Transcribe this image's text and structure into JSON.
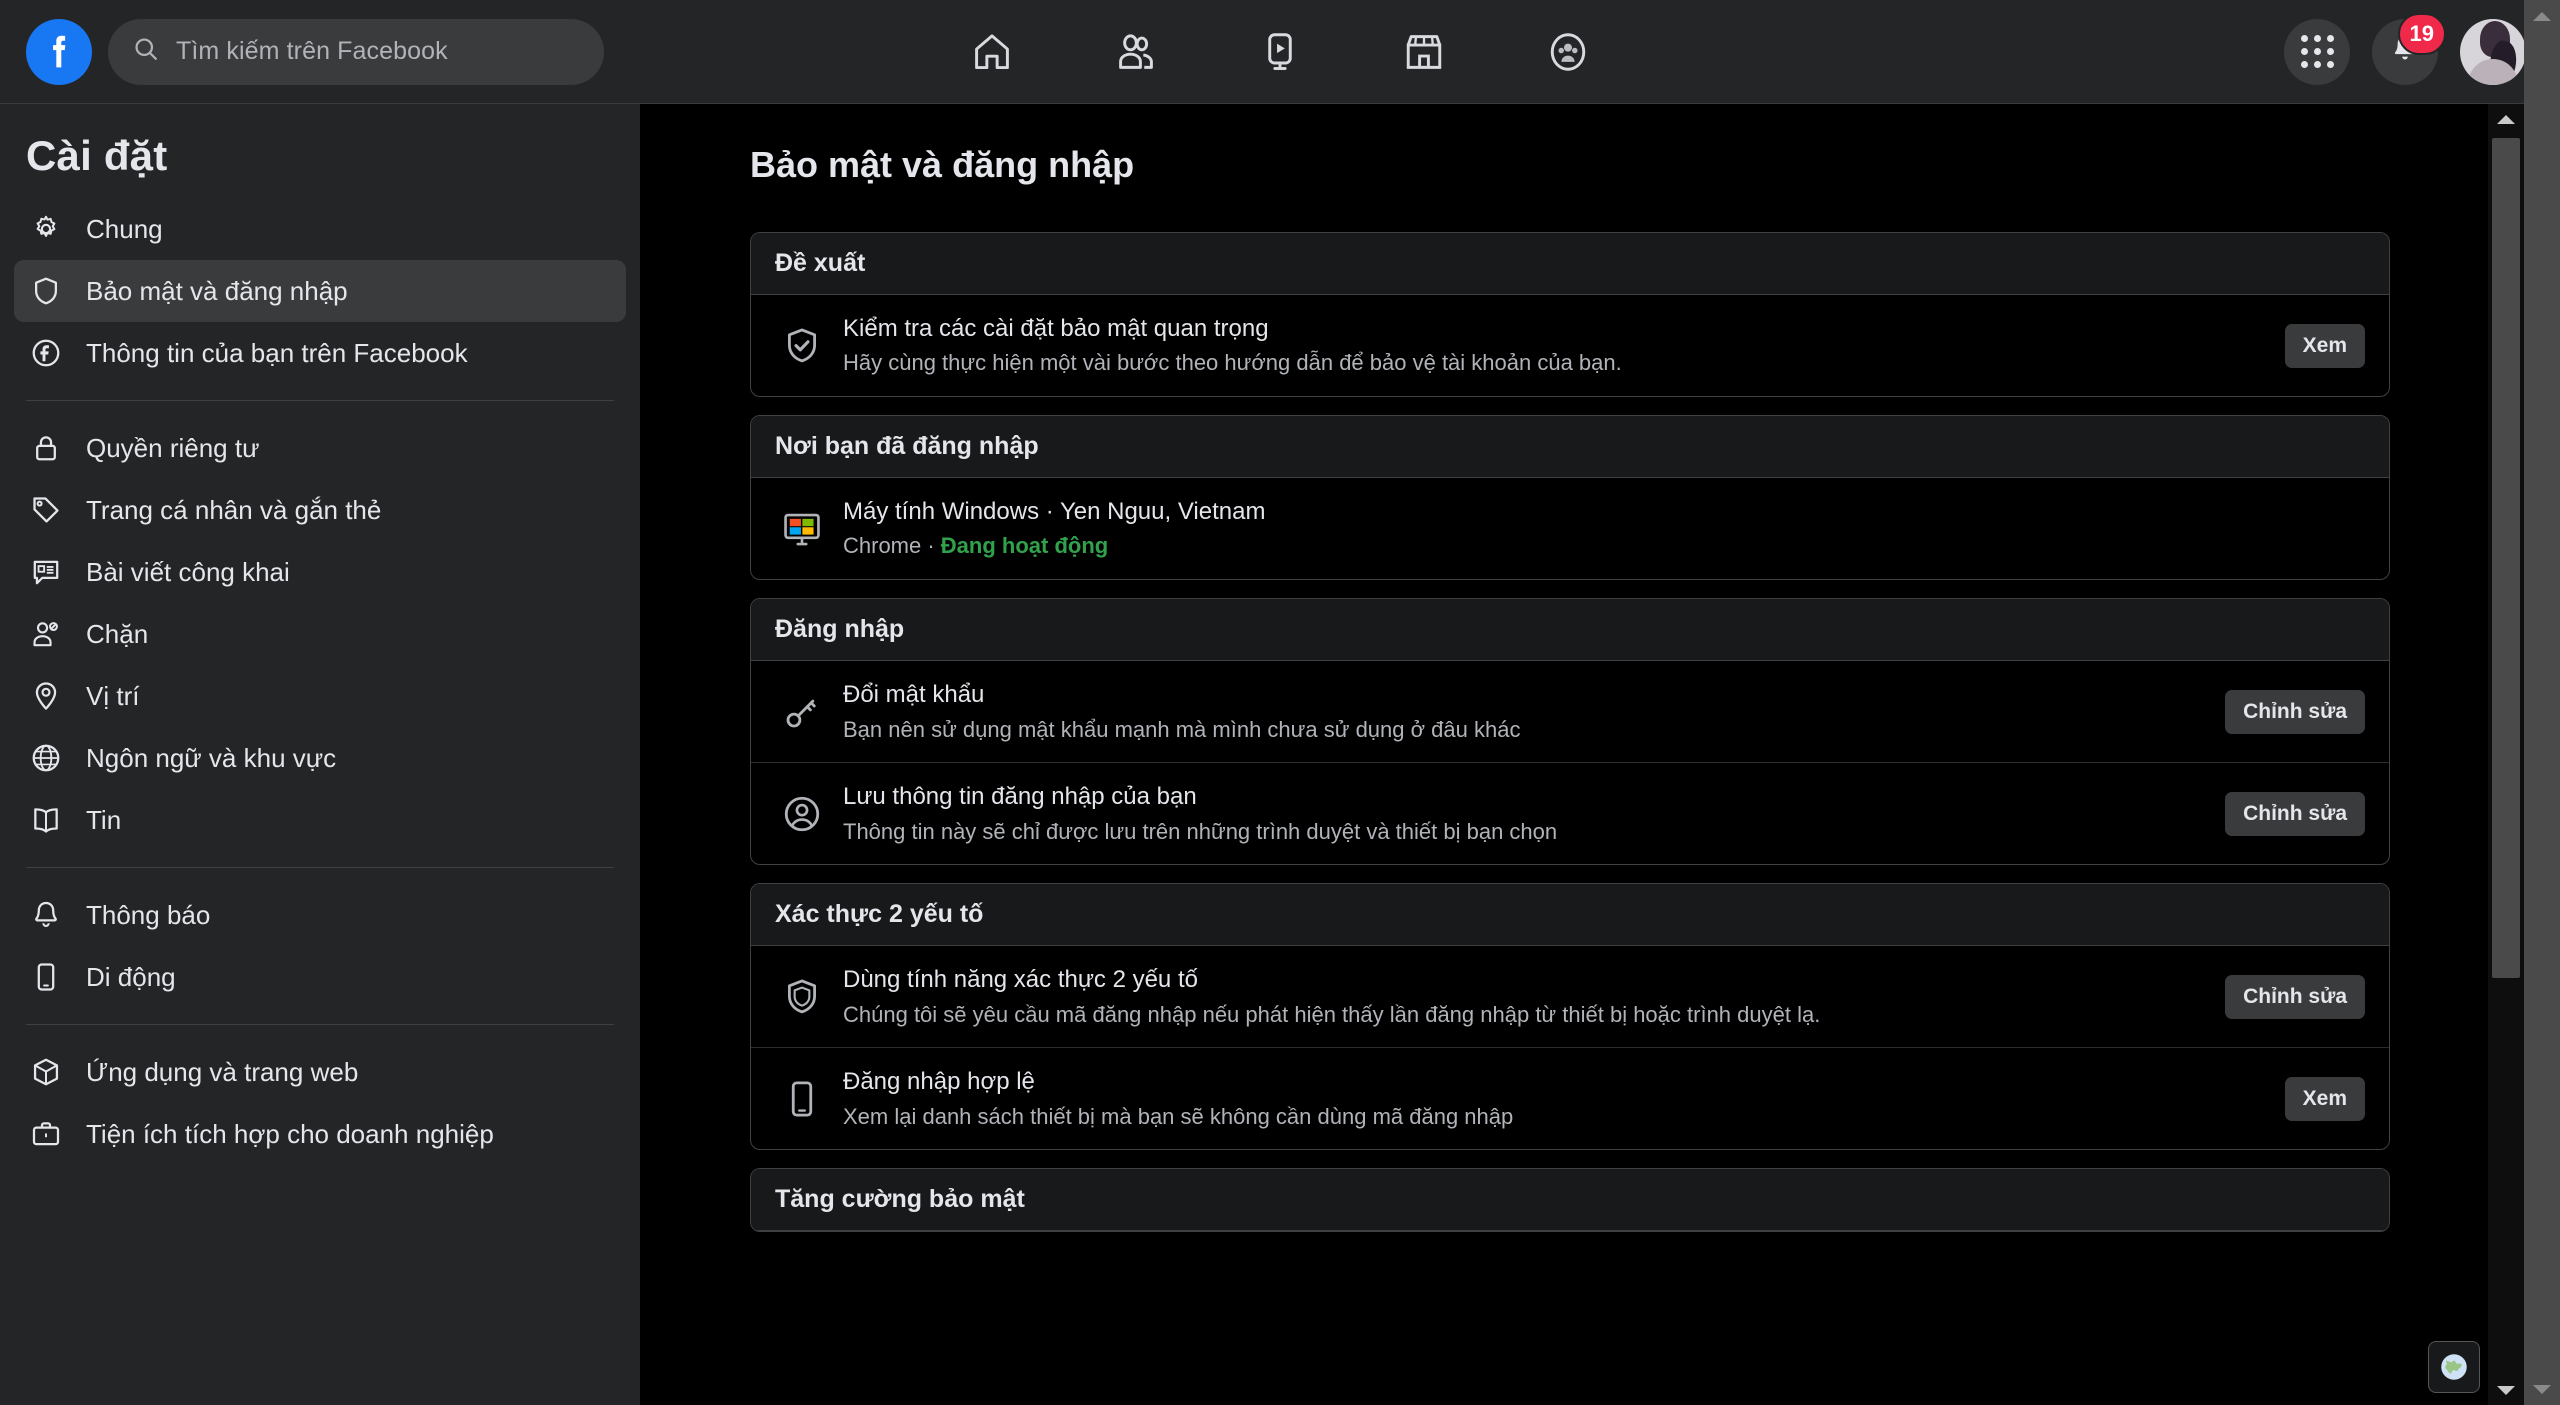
{
  "topbar": {
    "logo_icon": "facebook-logo",
    "search": {
      "placeholder": "Tìm kiếm trên Facebook",
      "value": "",
      "icon": "search-icon"
    },
    "nav": [
      {
        "name": "home",
        "icon": "home-icon"
      },
      {
        "name": "friends",
        "icon": "friends-icon"
      },
      {
        "name": "watch",
        "icon": "watch-video-icon"
      },
      {
        "name": "marketplace",
        "icon": "marketplace-store-icon"
      },
      {
        "name": "groups",
        "icon": "groups-icon"
      }
    ],
    "menu_icon": "grid-menu-icon",
    "notifications": {
      "icon": "bell-icon",
      "count": "19"
    },
    "account_icon": "profile-avatar"
  },
  "sidebar": {
    "title": "Cài đặt",
    "groups": [
      {
        "items": [
          {
            "label": "Chung",
            "icon": "gear-icon",
            "active": false
          },
          {
            "label": "Bảo mật và đăng nhập",
            "icon": "shield-icon",
            "active": true
          },
          {
            "label": "Thông tin của bạn trên Facebook",
            "icon": "facebook-circle-icon",
            "active": false
          }
        ]
      },
      {
        "items": [
          {
            "label": "Quyền riêng tư",
            "icon": "lock-icon",
            "active": false
          },
          {
            "label": "Trang cá nhân và gắn thẻ",
            "icon": "tag-icon",
            "active": false
          },
          {
            "label": "Bài viết công khai",
            "icon": "public-post-icon",
            "active": false
          },
          {
            "label": "Chặn",
            "icon": "block-user-icon",
            "active": false
          },
          {
            "label": "Vị trí",
            "icon": "location-pin-icon",
            "active": false
          },
          {
            "label": "Ngôn ngữ và khu vực",
            "icon": "globe-icon",
            "active": false
          },
          {
            "label": "Tin",
            "icon": "book-icon",
            "active": false
          }
        ]
      },
      {
        "items": [
          {
            "label": "Thông báo",
            "icon": "bell-icon",
            "active": false
          },
          {
            "label": "Di động",
            "icon": "mobile-phone-icon",
            "active": false
          }
        ]
      },
      {
        "items": [
          {
            "label": "Ứng dụng và trang web",
            "icon": "cube-icon",
            "active": false
          },
          {
            "label": "Tiện ích tích hợp cho doanh nghiệp",
            "icon": "briefcase-icon",
            "active": false
          }
        ]
      }
    ]
  },
  "main": {
    "page_title": "Bảo mật và đăng nhập",
    "cards": [
      {
        "heading": "Đề xuất",
        "rows": [
          {
            "icon": "shield-check-icon",
            "title": "Kiểm tra các cài đặt bảo mật quan trọng",
            "subtitle": "Hãy cùng thực hiện một vài bước theo hướng dẫn để bảo vệ tài khoản của bạn.",
            "button": "Xem"
          }
        ]
      },
      {
        "heading": "Nơi bạn đã đăng nhập",
        "rows": [
          {
            "icon": "windows-desktop-icon",
            "title": "Máy tính Windows · Yen Nguu, Vietnam",
            "subtitle_prefix": "Chrome · ",
            "subtitle_status": "Đang hoạt động",
            "button": ""
          }
        ]
      },
      {
        "heading": "Đăng nhập",
        "rows": [
          {
            "icon": "key-icon",
            "title": "Đổi mật khẩu",
            "subtitle": "Bạn nên sử dụng mật khẩu mạnh mà mình chưa sử dụng ở đâu khác",
            "button": "Chỉnh sửa"
          },
          {
            "icon": "user-circle-icon",
            "title": "Lưu thông tin đăng nhập của bạn",
            "subtitle": "Thông tin này sẽ chỉ được lưu trên những trình duyệt và thiết bị bạn chọn",
            "button": "Chỉnh sửa"
          }
        ]
      },
      {
        "heading": "Xác thực 2 yếu tố",
        "rows": [
          {
            "icon": "shield-icon",
            "title": "Dùng tính năng xác thực 2 yếu tố",
            "subtitle": "Chúng tôi sẽ yêu cầu mã đăng nhập nếu phát hiện thấy lần đăng nhập từ thiết bị hoặc trình duyệt lạ.",
            "button": "Chỉnh sửa"
          },
          {
            "icon": "mobile-phone-icon",
            "title": "Đăng nhập hợp lệ",
            "subtitle": "Xem lại danh sách thiết bị mà bạn sẽ không cần dùng mã đăng nhập",
            "button": "Xem"
          }
        ]
      },
      {
        "heading": "Tăng cường bảo mật",
        "rows": []
      }
    ]
  },
  "floating": {
    "globe_icon": "globe-icon"
  },
  "colors": {
    "brand_blue": "#1877f2",
    "badge_red": "#f02849",
    "status_green": "#31a24c",
    "surface": "#242526",
    "background": "#000000",
    "text_primary": "#e4e6eb",
    "text_secondary": "#b0b3b8"
  }
}
